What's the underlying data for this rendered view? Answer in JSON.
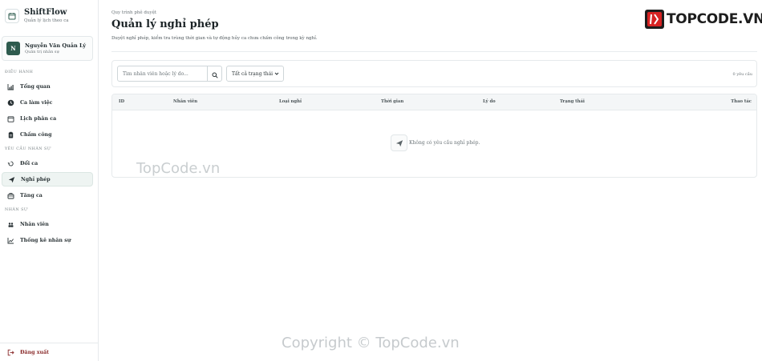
{
  "brand": {
    "name": "ShiftFlow",
    "subtitle": "Quản lý lịch theo ca"
  },
  "user": {
    "initial": "N",
    "name": "Nguyễn Văn Quản Lý",
    "role": "Quản trị nhân sự"
  },
  "sidebar": {
    "sections": [
      {
        "label": "ĐIỀU HÀNH",
        "items": [
          {
            "label": "Tổng quan",
            "icon": "chart-icon"
          },
          {
            "label": "Ca làm việc",
            "icon": "clock-icon"
          },
          {
            "label": "Lịch phân ca",
            "icon": "calendar-icon"
          },
          {
            "label": "Chấm công",
            "icon": "clipboard-icon"
          }
        ]
      },
      {
        "label": "YÊU CẦU NHÂN SỰ",
        "items": [
          {
            "label": "Đổi ca",
            "icon": "swap-icon"
          },
          {
            "label": "Nghỉ phép",
            "icon": "send-icon",
            "active": true
          },
          {
            "label": "Tăng ca",
            "icon": "overtime-icon"
          }
        ]
      },
      {
        "label": "NHÂN SỰ",
        "items": [
          {
            "label": "Nhân viên",
            "icon": "users-icon"
          },
          {
            "label": "Thống kê nhân sự",
            "icon": "line-chart-icon"
          }
        ]
      }
    ],
    "logout": "Đăng xuất"
  },
  "page": {
    "breadcrumb": "Quy trình phê duyệt",
    "title": "Quản lý nghỉ phép",
    "description": "Duyệt nghỉ phép, kiểm tra trùng thời gian và tự động hủy ca chưa chấm công trong kỳ nghỉ."
  },
  "toolbar": {
    "search_placeholder": "Tìm nhân viên hoặc lý do...",
    "status_filter": "Tất cả trạng thái",
    "count": "0 yêu cầu"
  },
  "table": {
    "columns": [
      "ID",
      "Nhân viên",
      "Loại nghỉ",
      "Thời gian",
      "Lý do",
      "Trạng thái",
      "Thao tác"
    ],
    "empty_text": "Không có yêu cầu nghỉ phép."
  },
  "watermarks": {
    "site": "TopCode.vn",
    "copyright": "Copyright © TopCode.vn",
    "logo": "TOPCODE.VN"
  },
  "colors": {
    "accent": "#2e5b4e",
    "logout": "#8a2b2b",
    "active_bg": "#eef4f2"
  }
}
